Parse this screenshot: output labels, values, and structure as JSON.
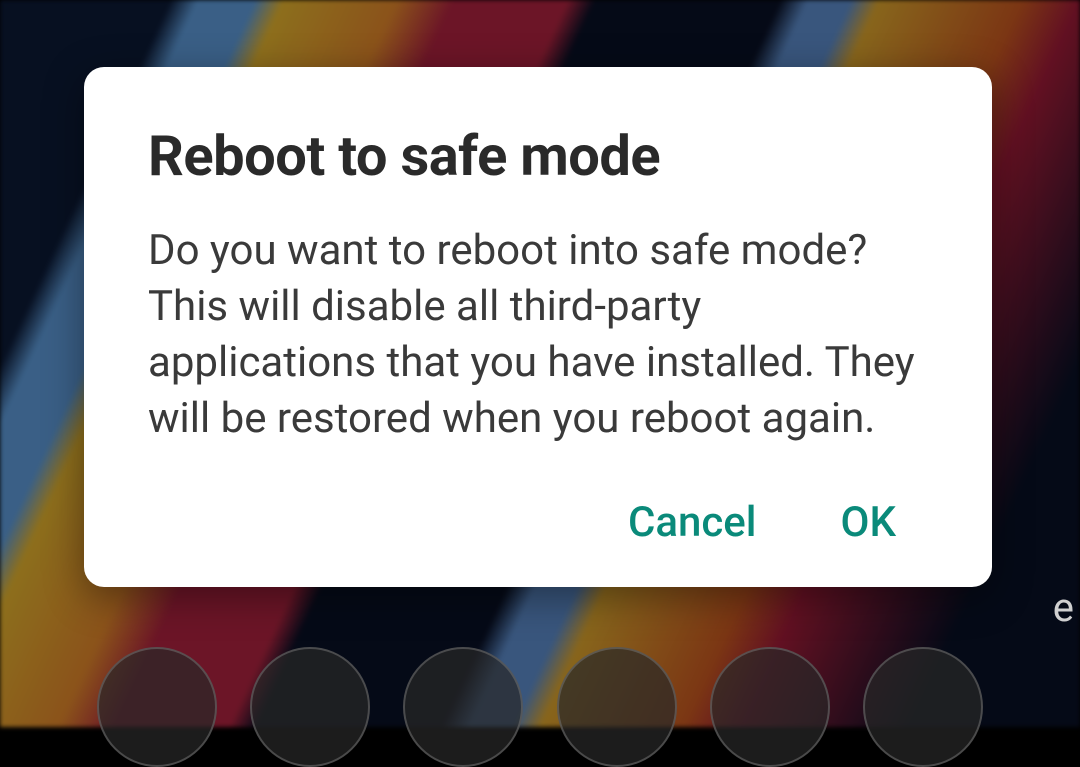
{
  "dialog": {
    "title": "Reboot to safe mode",
    "message": "Do you want to reboot into safe mode? This will disable all third-party applications that you have installed. They will be restored when you reboot again.",
    "cancel_label": "Cancel",
    "ok_label": "OK"
  },
  "bg_fragment": "e"
}
